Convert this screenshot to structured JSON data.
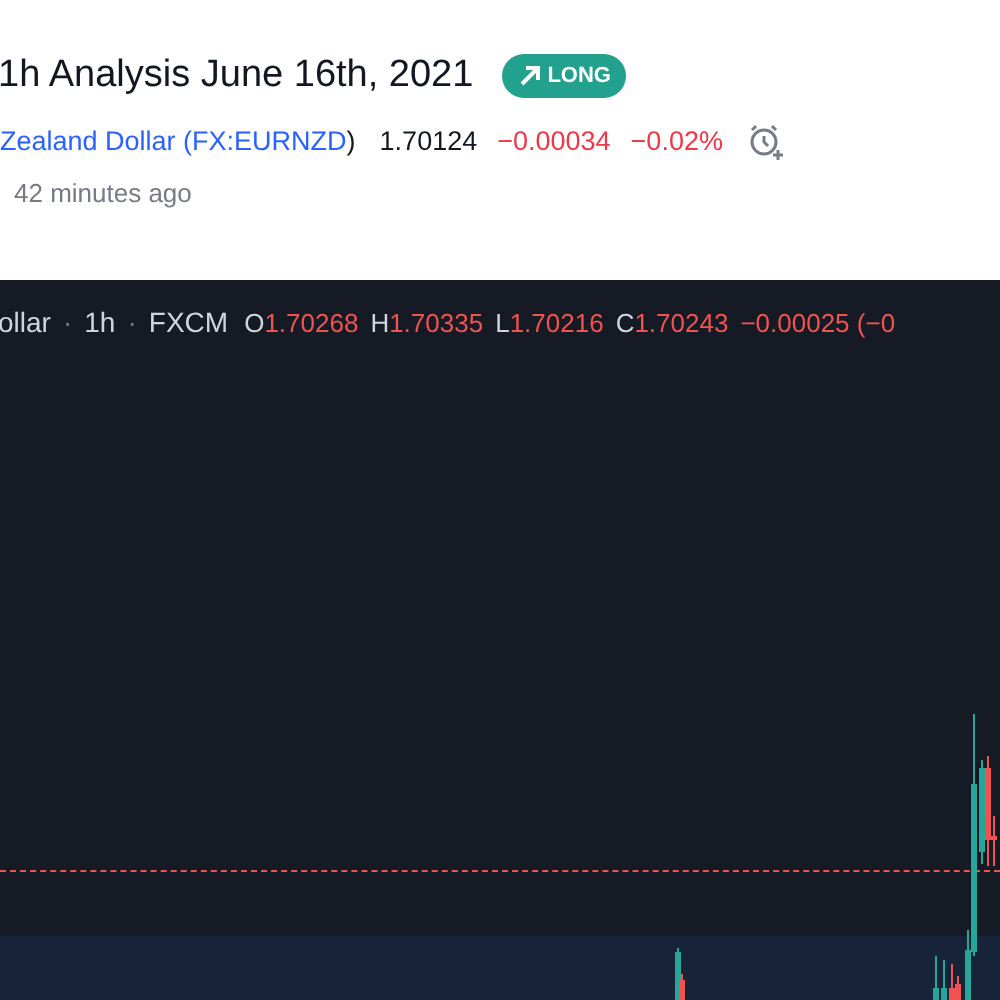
{
  "idea": {
    "title": "1h Analysis June 16th, 2021",
    "badge": {
      "label": "LONG"
    }
  },
  "symbol": {
    "name": "Zealand Dollar (FX:EURNZD",
    "close_paren": ")",
    "price": "1.70124",
    "change": "−0.00034",
    "change_percent": "−0.02%"
  },
  "published": "42 minutes ago",
  "legend": {
    "symbol": "ollar",
    "separator_1": "·",
    "interval": "1h",
    "separator_2": "·",
    "source": "FXCM",
    "ohlc": [
      {
        "label": "O",
        "value": "1.70268"
      },
      {
        "label": "H",
        "value": "1.70335"
      },
      {
        "label": "L",
        "value": "1.70216"
      },
      {
        "label": "C",
        "value": "1.70243"
      }
    ],
    "change": "−0.00025 (−0"
  }
}
